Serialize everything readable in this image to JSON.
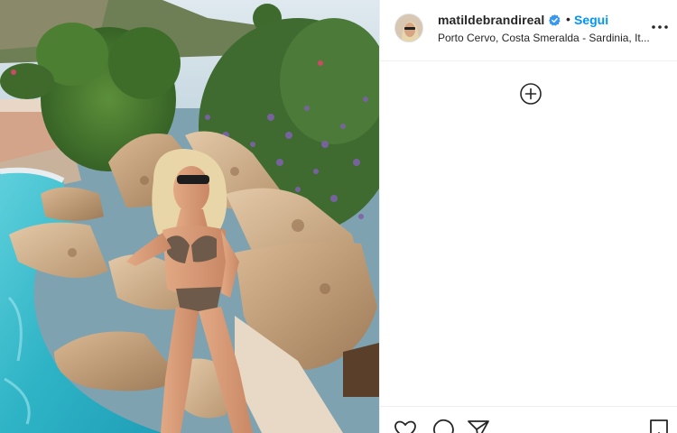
{
  "post": {
    "image_alt": "",
    "header": {
      "username": "matildebrandireal",
      "verified": true,
      "separator": "•",
      "follow_label": "Segui",
      "location": "Porto Cervo, Costa Smeralda - Sardinia, It...",
      "more_icon": "more-horizontal-icon"
    },
    "comments": {
      "add_icon": "plus-circle-icon"
    },
    "actions": {
      "like_icon": "heart-icon",
      "comment_icon": "speech-bubble-icon",
      "share_icon": "paper-plane-icon",
      "save_icon": "bookmark-icon"
    },
    "colors": {
      "link_blue": "#0095f6",
      "verified_blue": "#3897f0",
      "text": "#262626",
      "border": "#efefef"
    }
  }
}
